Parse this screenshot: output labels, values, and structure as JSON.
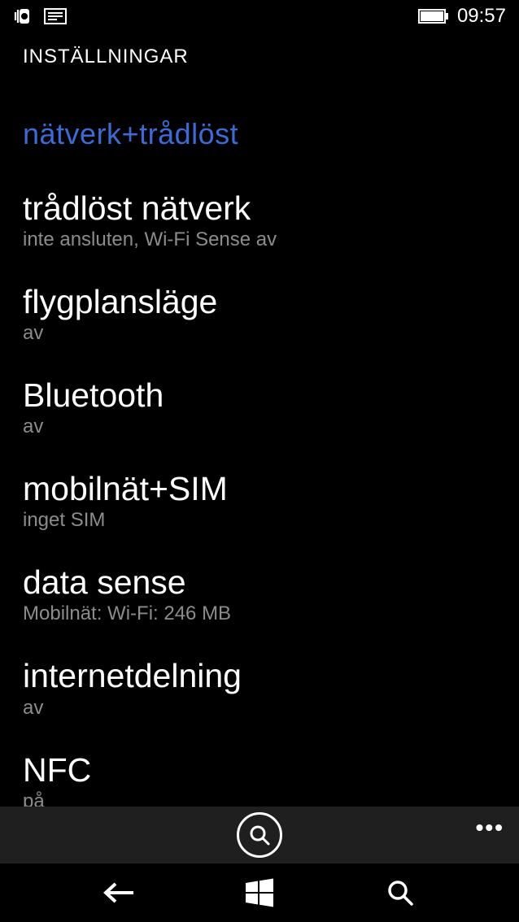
{
  "status": {
    "time": "09:57"
  },
  "header": {
    "title": "INSTÄLLNINGAR"
  },
  "pivot": {
    "title": "nätverk+trådlöst"
  },
  "items": [
    {
      "title": "trådlöst nätverk",
      "subtitle": "inte ansluten, Wi-Fi Sense av"
    },
    {
      "title": "flygplansläge",
      "subtitle": "av"
    },
    {
      "title": "Bluetooth",
      "subtitle": "av"
    },
    {
      "title": "mobilnät+SIM",
      "subtitle": "inget SIM"
    },
    {
      "title": "data sense",
      "subtitle": "Mobilnät:  Wi-Fi: 246 MB"
    },
    {
      "title": "internetdelning",
      "subtitle": "av"
    },
    {
      "title": "NFC",
      "subtitle": "på"
    }
  ]
}
